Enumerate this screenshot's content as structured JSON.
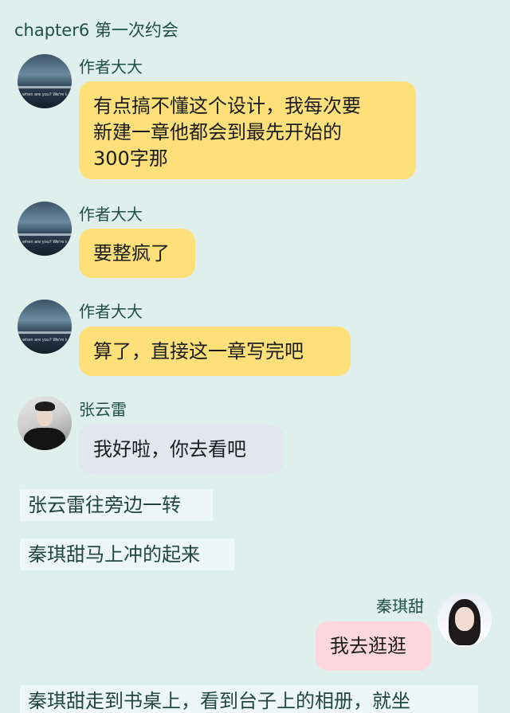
{
  "chapter_title": "chapter6 第一次约会",
  "messages": [
    {
      "sender": "作者大大",
      "text": "有点搞不懂这个设计，我每次要\n新建一章他都会到最先开始的\n300字那",
      "avatar_caption": "when are you? We're in"
    },
    {
      "sender": "作者大大",
      "text": "要整疯了",
      "avatar_caption": "when are you? We're in"
    },
    {
      "sender": "作者大大",
      "text": "算了，直接这一章写完吧",
      "avatar_caption": "when are you? We're in"
    },
    {
      "sender": "张云雷",
      "text": "我好啦，你去看吧"
    }
  ],
  "narration": [
    "张云雷往旁边一转",
    "秦琪甜马上冲的起来"
  ],
  "reply": {
    "sender": "秦琪甜",
    "text": "我去逛逛"
  },
  "narration_cut": "秦琪甜走到书桌上，看到台子上的相册，就坐",
  "colors": {
    "background": "#dff0ec",
    "bubble_author": "#fde07a",
    "bubble_zhang": "#e4e6ee",
    "bubble_qin": "#fdd6e0",
    "narration_bg": "#edf7f5"
  }
}
